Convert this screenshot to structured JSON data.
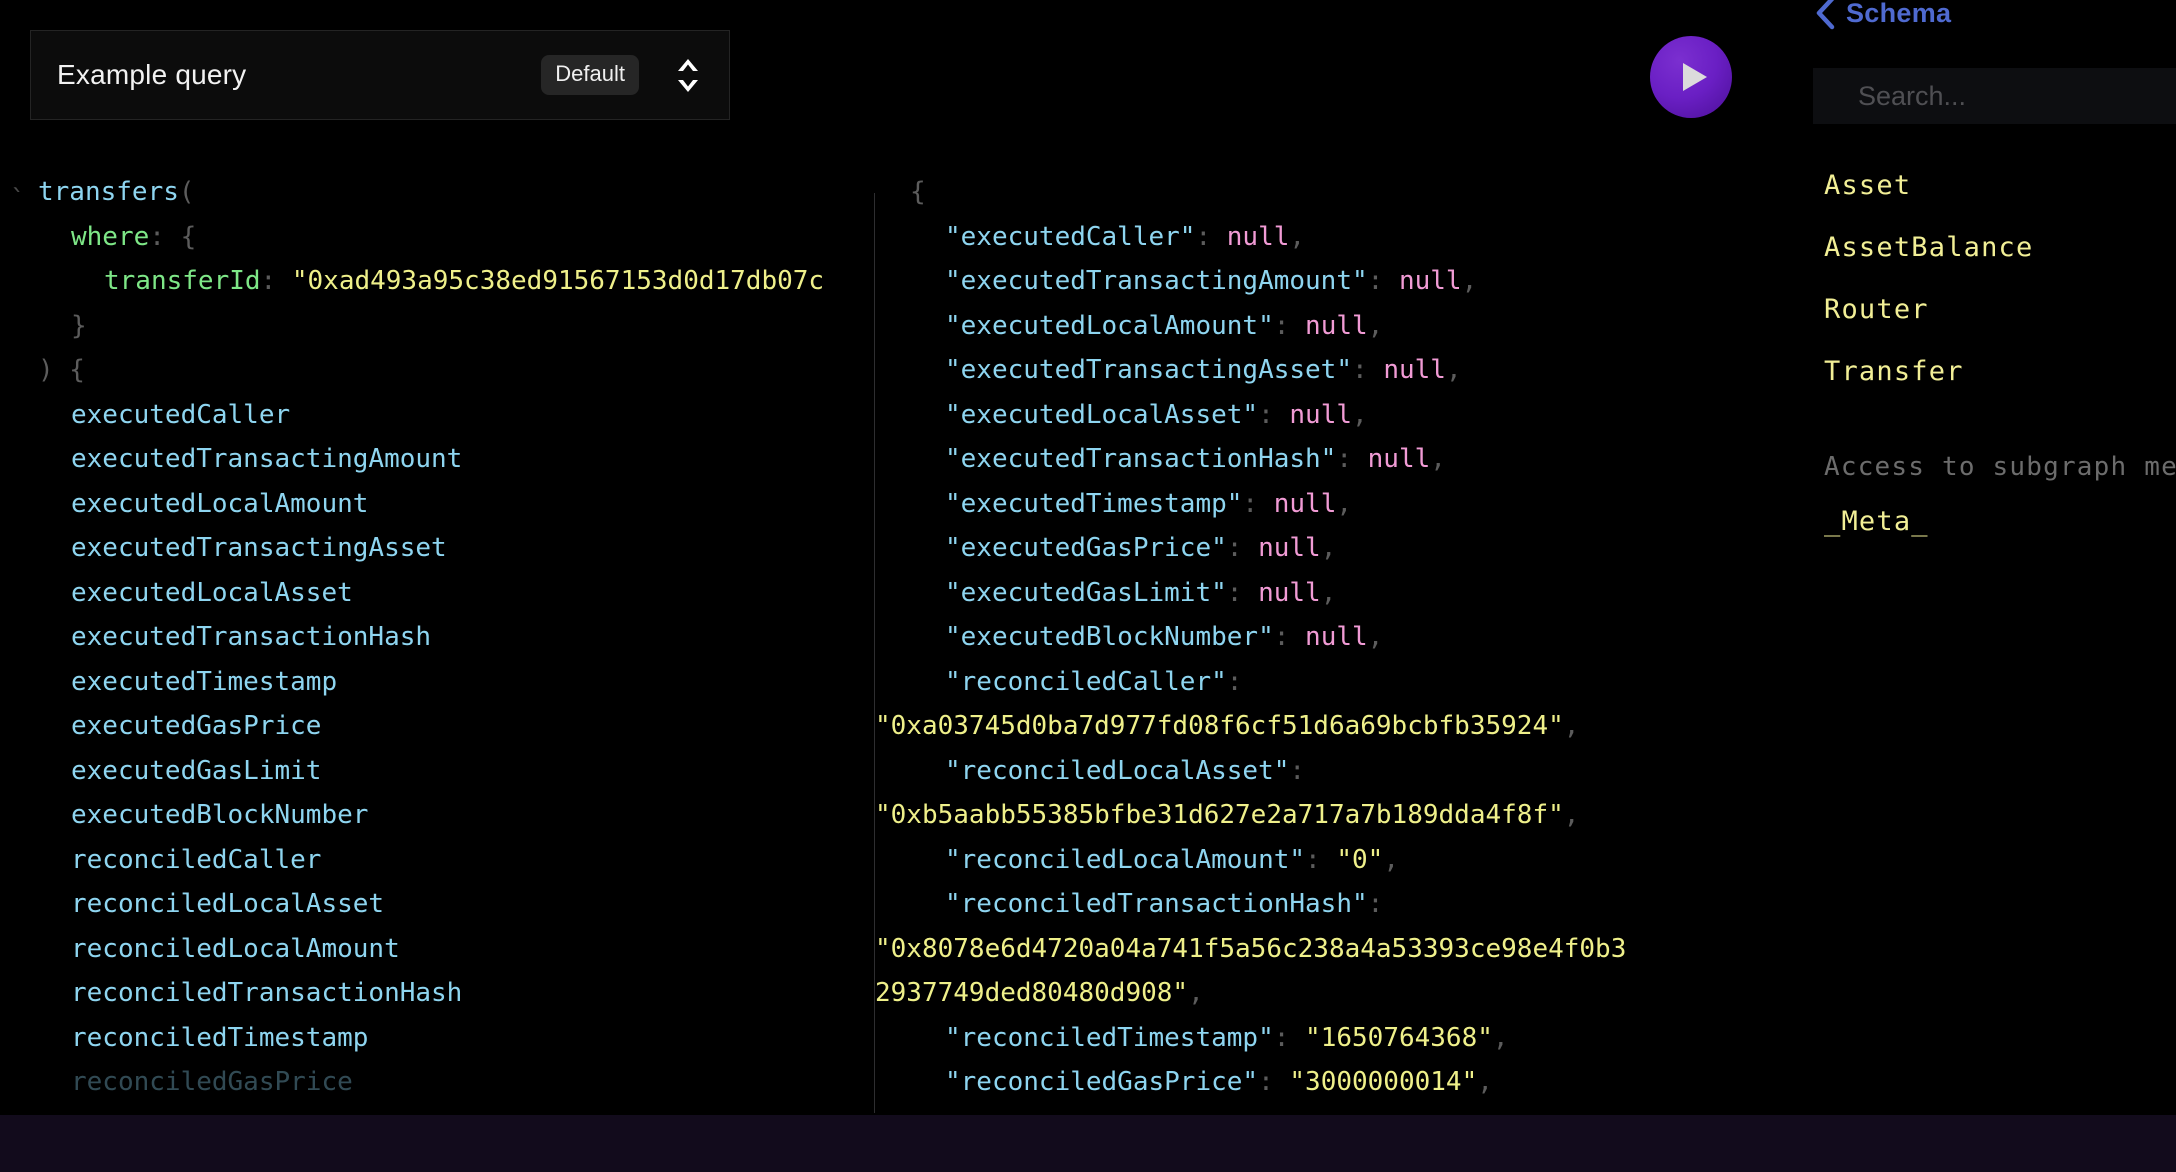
{
  "header": {
    "query_title": "Example query",
    "default_badge": "Default",
    "stepper_icon": "chevron-up-down-icon",
    "execute_icon": "play-icon"
  },
  "editor": {
    "tick": "`",
    "lines": [
      {
        "indent": 0,
        "tokens": [
          {
            "c": "t-field",
            "t": "transfers"
          },
          {
            "c": "t-punc",
            "t": "("
          }
        ]
      },
      {
        "indent": 1,
        "tokens": [
          {
            "c": "t-arg",
            "t": "where"
          },
          {
            "c": "t-punc",
            "t": ": {"
          }
        ]
      },
      {
        "indent": 2,
        "tokens": [
          {
            "c": "t-arg",
            "t": "transferId"
          },
          {
            "c": "t-punc",
            "t": ": "
          },
          {
            "c": "t-str",
            "t": "\"0xad493a95c38ed91567153d0d17db07c"
          }
        ]
      },
      {
        "indent": 1,
        "tokens": [
          {
            "c": "t-punc",
            "t": "}"
          }
        ]
      },
      {
        "indent": 0,
        "tokens": [
          {
            "c": "t-punc",
            "t": ") {"
          }
        ]
      },
      {
        "indent": 1,
        "tokens": [
          {
            "c": "t-field",
            "t": "executedCaller"
          }
        ]
      },
      {
        "indent": 1,
        "tokens": [
          {
            "c": "t-field",
            "t": "executedTransactingAmount"
          }
        ]
      },
      {
        "indent": 1,
        "tokens": [
          {
            "c": "t-field",
            "t": "executedLocalAmount"
          }
        ]
      },
      {
        "indent": 1,
        "tokens": [
          {
            "c": "t-field",
            "t": "executedTransactingAsset"
          }
        ]
      },
      {
        "indent": 1,
        "tokens": [
          {
            "c": "t-field",
            "t": "executedLocalAsset"
          }
        ]
      },
      {
        "indent": 1,
        "tokens": [
          {
            "c": "t-field",
            "t": "executedTransactionHash"
          }
        ]
      },
      {
        "indent": 1,
        "tokens": [
          {
            "c": "t-field",
            "t": "executedTimestamp"
          }
        ]
      },
      {
        "indent": 1,
        "tokens": [
          {
            "c": "t-field",
            "t": "executedGasPrice"
          }
        ]
      },
      {
        "indent": 1,
        "tokens": [
          {
            "c": "t-field",
            "t": "executedGasLimit"
          }
        ]
      },
      {
        "indent": 1,
        "tokens": [
          {
            "c": "t-field",
            "t": "executedBlockNumber"
          }
        ]
      },
      {
        "indent": 1,
        "tokens": [
          {
            "c": "t-field",
            "t": "reconciledCaller"
          }
        ]
      },
      {
        "indent": 1,
        "tokens": [
          {
            "c": "t-field",
            "t": "reconciledLocalAsset"
          }
        ]
      },
      {
        "indent": 1,
        "tokens": [
          {
            "c": "t-field",
            "t": "reconciledLocalAmount"
          }
        ]
      },
      {
        "indent": 1,
        "tokens": [
          {
            "c": "t-field",
            "t": "reconciledTransactionHash"
          }
        ]
      },
      {
        "indent": 1,
        "tokens": [
          {
            "c": "t-field",
            "t": "reconciledTimestamp"
          }
        ]
      },
      {
        "indent": 1,
        "fade": true,
        "tokens": [
          {
            "c": "t-field",
            "t": "reconciledGasPrice"
          }
        ]
      }
    ]
  },
  "result": {
    "lines": [
      {
        "indent": 1,
        "tokens": [
          {
            "c": "t-punc",
            "t": "{"
          }
        ]
      },
      {
        "indent": 2,
        "tokens": [
          {
            "c": "t-field",
            "t": "\"executedCaller\""
          },
          {
            "c": "t-punc",
            "t": ": "
          },
          {
            "c": "t-null",
            "t": "null"
          },
          {
            "c": "t-punc",
            "t": ","
          }
        ]
      },
      {
        "indent": 2,
        "tokens": [
          {
            "c": "t-field",
            "t": "\"executedTransactingAmount\""
          },
          {
            "c": "t-punc",
            "t": ": "
          },
          {
            "c": "t-null",
            "t": "null"
          },
          {
            "c": "t-punc",
            "t": ","
          }
        ]
      },
      {
        "indent": 2,
        "tokens": [
          {
            "c": "t-field",
            "t": "\"executedLocalAmount\""
          },
          {
            "c": "t-punc",
            "t": ": "
          },
          {
            "c": "t-null",
            "t": "null"
          },
          {
            "c": "t-punc",
            "t": ","
          }
        ]
      },
      {
        "indent": 2,
        "tokens": [
          {
            "c": "t-field",
            "t": "\"executedTransactingAsset\""
          },
          {
            "c": "t-punc",
            "t": ": "
          },
          {
            "c": "t-null",
            "t": "null"
          },
          {
            "c": "t-punc",
            "t": ","
          }
        ]
      },
      {
        "indent": 2,
        "tokens": [
          {
            "c": "t-field",
            "t": "\"executedLocalAsset\""
          },
          {
            "c": "t-punc",
            "t": ": "
          },
          {
            "c": "t-null",
            "t": "null"
          },
          {
            "c": "t-punc",
            "t": ","
          }
        ]
      },
      {
        "indent": 2,
        "tokens": [
          {
            "c": "t-field",
            "t": "\"executedTransactionHash\""
          },
          {
            "c": "t-punc",
            "t": ": "
          },
          {
            "c": "t-null",
            "t": "null"
          },
          {
            "c": "t-punc",
            "t": ","
          }
        ]
      },
      {
        "indent": 2,
        "tokens": [
          {
            "c": "t-field",
            "t": "\"executedTimestamp\""
          },
          {
            "c": "t-punc",
            "t": ": "
          },
          {
            "c": "t-null",
            "t": "null"
          },
          {
            "c": "t-punc",
            "t": ","
          }
        ]
      },
      {
        "indent": 2,
        "tokens": [
          {
            "c": "t-field",
            "t": "\"executedGasPrice\""
          },
          {
            "c": "t-punc",
            "t": ": "
          },
          {
            "c": "t-null",
            "t": "null"
          },
          {
            "c": "t-punc",
            "t": ","
          }
        ]
      },
      {
        "indent": 2,
        "tokens": [
          {
            "c": "t-field",
            "t": "\"executedGasLimit\""
          },
          {
            "c": "t-punc",
            "t": ": "
          },
          {
            "c": "t-null",
            "t": "null"
          },
          {
            "c": "t-punc",
            "t": ","
          }
        ]
      },
      {
        "indent": 2,
        "tokens": [
          {
            "c": "t-field",
            "t": "\"executedBlockNumber\""
          },
          {
            "c": "t-punc",
            "t": ": "
          },
          {
            "c": "t-null",
            "t": "null"
          },
          {
            "c": "t-punc",
            "t": ","
          }
        ]
      },
      {
        "indent": 2,
        "tokens": [
          {
            "c": "t-field",
            "t": "\"reconciledCaller\""
          },
          {
            "c": "t-punc",
            "t": ":"
          }
        ]
      },
      {
        "indent": 0,
        "tokens": [
          {
            "c": "t-str",
            "t": "\"0xa03745d0ba7d977fd08f6cf51d6a69bcbfb35924\""
          },
          {
            "c": "t-punc",
            "t": ","
          }
        ]
      },
      {
        "indent": 2,
        "tokens": [
          {
            "c": "t-field",
            "t": "\"reconciledLocalAsset\""
          },
          {
            "c": "t-punc",
            "t": ":"
          }
        ]
      },
      {
        "indent": 0,
        "tokens": [
          {
            "c": "t-str",
            "t": "\"0xb5aabb55385bfbe31d627e2a717a7b189dda4f8f\""
          },
          {
            "c": "t-punc",
            "t": ","
          }
        ]
      },
      {
        "indent": 2,
        "tokens": [
          {
            "c": "t-field",
            "t": "\"reconciledLocalAmount\""
          },
          {
            "c": "t-punc",
            "t": ": "
          },
          {
            "c": "t-str",
            "t": "\"0\""
          },
          {
            "c": "t-punc",
            "t": ","
          }
        ]
      },
      {
        "indent": 2,
        "tokens": [
          {
            "c": "t-field",
            "t": "\"reconciledTransactionHash\""
          },
          {
            "c": "t-punc",
            "t": ":"
          }
        ]
      },
      {
        "indent": 0,
        "tokens": [
          {
            "c": "t-str",
            "t": "\"0x8078e6d4720a04a741f5a56c238a4a53393ce98e4f0b3"
          }
        ]
      },
      {
        "indent": 0,
        "tokens": [
          {
            "c": "t-str",
            "t": "2937749ded80480d908\""
          },
          {
            "c": "t-punc",
            "t": ","
          }
        ]
      },
      {
        "indent": 2,
        "tokens": [
          {
            "c": "t-field",
            "t": "\"reconciledTimestamp\""
          },
          {
            "c": "t-punc",
            "t": ": "
          },
          {
            "c": "t-str",
            "t": "\"1650764368\""
          },
          {
            "c": "t-punc",
            "t": ","
          }
        ]
      },
      {
        "indent": 2,
        "tokens": [
          {
            "c": "t-field",
            "t": "\"reconciledGasPrice\""
          },
          {
            "c": "t-punc",
            "t": ": "
          },
          {
            "c": "t-str",
            "t": "\"3000000014\""
          },
          {
            "c": "t-punc",
            "t": ","
          }
        ]
      }
    ]
  },
  "schema": {
    "back_icon": "chevron-left-icon",
    "title": "Schema",
    "search_placeholder": "Search...",
    "search_value": "",
    "types": [
      "Asset",
      "AssetBalance",
      "Router",
      "Transfer"
    ],
    "note": "Access to subgraph me",
    "meta_type": "_Meta_"
  },
  "colors": {
    "background": "#000000",
    "accent_purple": "#6a1fc4",
    "schema_blue": "#4f6ad0",
    "type_yellow": "#f2ef96",
    "key_cyan": "#8ed5f0",
    "null_pink": "#f19bd5",
    "string_yellow": "#eff08a",
    "arg_green": "#7ee787",
    "footer": "#120b1c"
  }
}
